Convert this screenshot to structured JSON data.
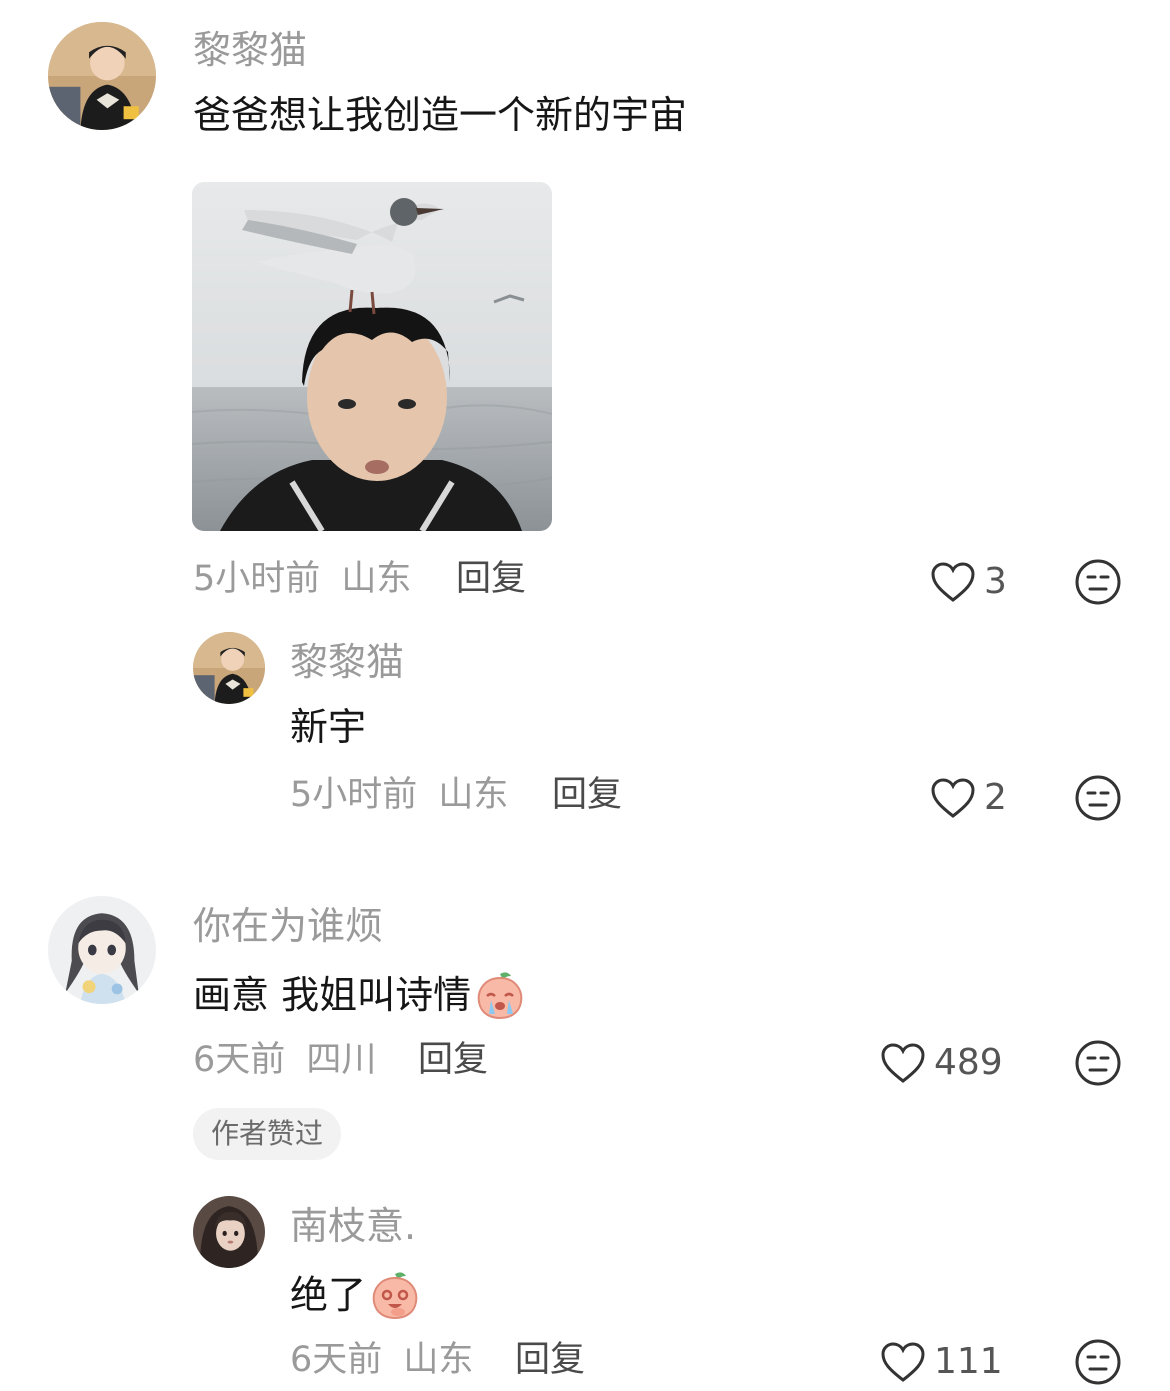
{
  "comments": [
    {
      "username": "黎黎猫",
      "text": "爸爸想让我创造一个新的宇宙",
      "has_image": true,
      "time": "5小时前",
      "location": "山东",
      "reply_label": "回复",
      "likes": "3",
      "replies": [
        {
          "username": "黎黎猫",
          "text": "新宇",
          "time": "5小时前",
          "location": "山东",
          "reply_label": "回复",
          "likes": "2"
        }
      ]
    },
    {
      "username": "你在为谁烦",
      "text": "画意 我姐叫诗情",
      "emoji": "crying-peach-emoji",
      "time": "6天前",
      "location": "四川",
      "reply_label": "回复",
      "likes": "489",
      "badge": "作者赞过",
      "replies": [
        {
          "username": "南枝意.",
          "text": "绝了",
          "emoji": "laughing-peach-emoji",
          "time": "6天前",
          "location": "山东",
          "reply_label": "回复",
          "likes": "111"
        }
      ]
    }
  ],
  "colors": {
    "username": "#9a9a9a",
    "text": "#161616",
    "meta": "#9a9a9a",
    "reply": "#4a4a4a",
    "badge_bg": "#f2f2f2"
  }
}
